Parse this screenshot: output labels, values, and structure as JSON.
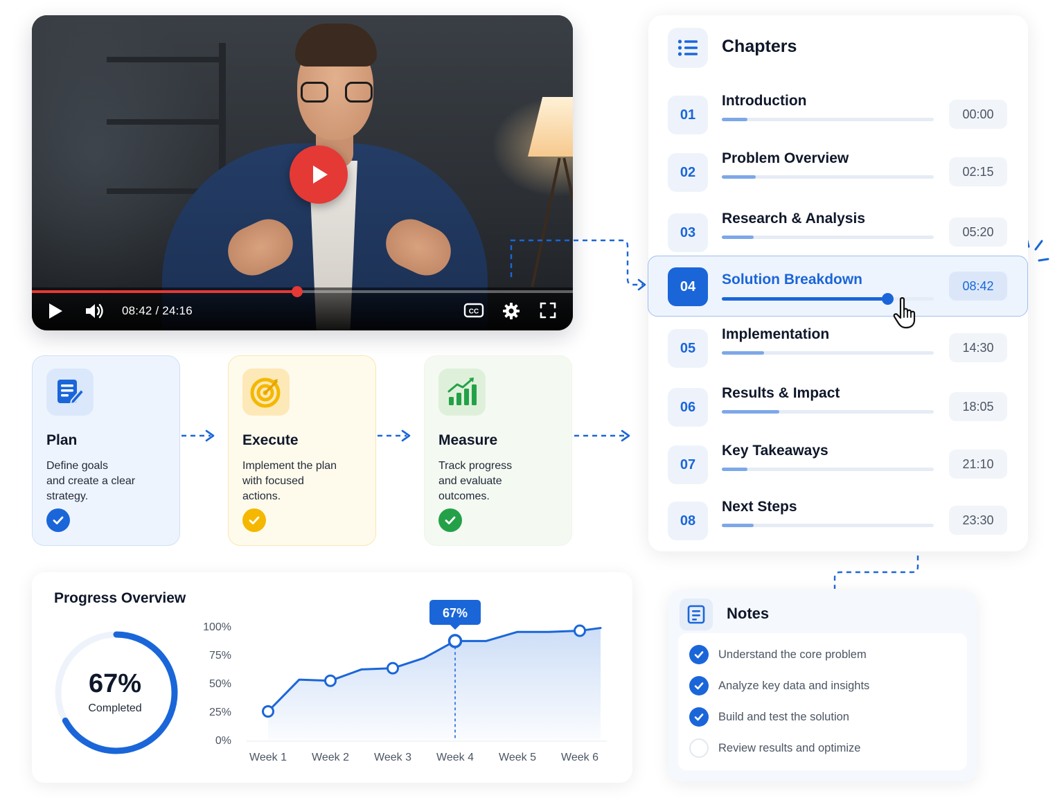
{
  "player": {
    "time": "08:42 / 24:16",
    "progress": 0.49
  },
  "steps": [
    {
      "title": "Plan",
      "description": [
        "Define goals",
        "and create a clear",
        "strategy."
      ],
      "icon": "document-pen-icon",
      "color": "#1a66d9"
    },
    {
      "title": "Execute",
      "description": [
        "Implement the plan",
        "with focused",
        "actions."
      ],
      "icon": "target-icon",
      "color": "#f5b700"
    },
    {
      "title": "Measure",
      "description": [
        "Track progress",
        "and evaluate",
        "outcomes."
      ],
      "icon": "bar-chart-growth-icon",
      "color": "#24a148"
    }
  ],
  "progress_overview": {
    "title": "Progress Overview",
    "percent_label": "67%",
    "completed_label": "Completed",
    "completed_fraction": 0.67
  },
  "chart_data": {
    "type": "line",
    "categories": [
      "Week 1",
      "Week 2",
      "Week 3",
      "Week 4",
      "Week 5",
      "Week 6"
    ],
    "x": [
      1,
      1.5,
      2,
      2.5,
      3,
      3.5,
      4,
      4.5,
      5,
      5.5,
      6
    ],
    "values": [
      25,
      53,
      52,
      62,
      63,
      72,
      87,
      87,
      95,
      95,
      96
    ],
    "markers_at": [
      1,
      2,
      3,
      4,
      6
    ],
    "highlight": {
      "category": "Week 4",
      "label": "67%"
    },
    "yticks": [
      "0%",
      "25%",
      "50%",
      "75%",
      "100%"
    ],
    "ylim": [
      0,
      100
    ],
    "grid": false,
    "color": "#1a66d9"
  },
  "chapters": {
    "title": "Chapters",
    "items": [
      {
        "num": "01",
        "title": "Introduction",
        "time": "00:00",
        "progress": 0.12,
        "active": false
      },
      {
        "num": "02",
        "title": "Problem Overview",
        "time": "02:15",
        "progress": 0.16,
        "active": false
      },
      {
        "num": "03",
        "title": "Research & Analysis",
        "time": "05:20",
        "progress": 0.15,
        "active": false
      },
      {
        "num": "04",
        "title": "Solution Breakdown",
        "time": "08:42",
        "progress": 0.78,
        "active": true
      },
      {
        "num": "05",
        "title": "Implementation",
        "time": "14:30",
        "progress": 0.2,
        "active": false
      },
      {
        "num": "06",
        "title": "Results & Impact",
        "time": "18:05",
        "progress": 0.27,
        "active": false
      },
      {
        "num": "07",
        "title": "Key Takeaways",
        "time": "21:10",
        "progress": 0.12,
        "active": false
      },
      {
        "num": "08",
        "title": "Next Steps",
        "time": "23:30",
        "progress": 0.15,
        "active": false
      }
    ]
  },
  "notes": {
    "title": "Notes",
    "items": [
      {
        "text": "Understand the core problem",
        "checked": true
      },
      {
        "text": "Analyze key data and insights",
        "checked": true
      },
      {
        "text": "Build and test the solution",
        "checked": true
      },
      {
        "text": "Review results and optimize",
        "checked": false
      }
    ]
  },
  "colors": {
    "accent": "#1a66d9",
    "player_red": "#e53935",
    "execute_yellow": "#f5b700",
    "measure_green": "#24a148"
  }
}
